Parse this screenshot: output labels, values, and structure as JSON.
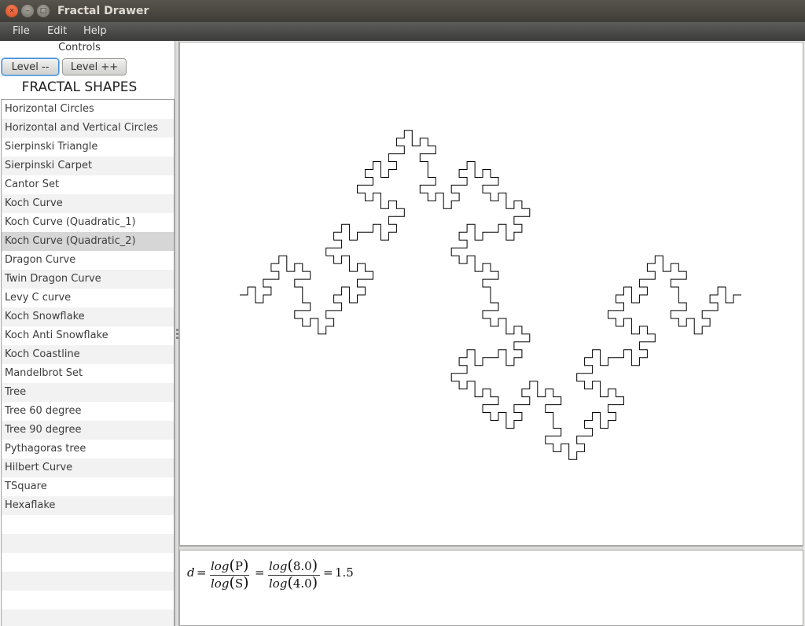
{
  "window": {
    "title": "Fractal Drawer",
    "close": "×",
    "minimize": "–",
    "maximize": "□"
  },
  "menu": [
    "File",
    "Edit",
    "Help"
  ],
  "controls": {
    "label": "Controls",
    "level_down": "Level --",
    "level_up": "Level ++",
    "shapes_title": "FRACTAL SHAPES"
  },
  "shapes": [
    "Horizontal Circles",
    "Horizontal and Vertical Circles",
    "Sierpinski Triangle",
    "Sierpinski Carpet",
    "Cantor Set",
    "Koch Curve",
    "Koch Curve (Quadratic_1)",
    "Koch Curve (Quadratic_2)",
    "Dragon Curve",
    "Twin Dragon Curve",
    "Levy C curve",
    "Koch Snowflake",
    "Koch Anti Snowflake",
    "Koch Coastline",
    "Mandelbrot Set",
    "Tree",
    "Tree 60 degree",
    "Tree 90 degree",
    "Pythagoras tree",
    "Hilbert Curve",
    "TSquare",
    "Hexaflake"
  ],
  "selected_shape": "Koch Curve (Quadratic_2)",
  "formula": {
    "lhs": "d",
    "eq": "=",
    "num1": "log",
    "num1_arg": "P",
    "den1": "log",
    "den1_arg": "S",
    "num2": "log",
    "num2_arg": "8.0",
    "den2": "log",
    "den2_arg": "4.0",
    "result": "1.5"
  },
  "fractal": {
    "type": "Koch Curve (Quadratic_2)",
    "pieces": 8,
    "scale": 4,
    "stroke_color": "#000000"
  }
}
